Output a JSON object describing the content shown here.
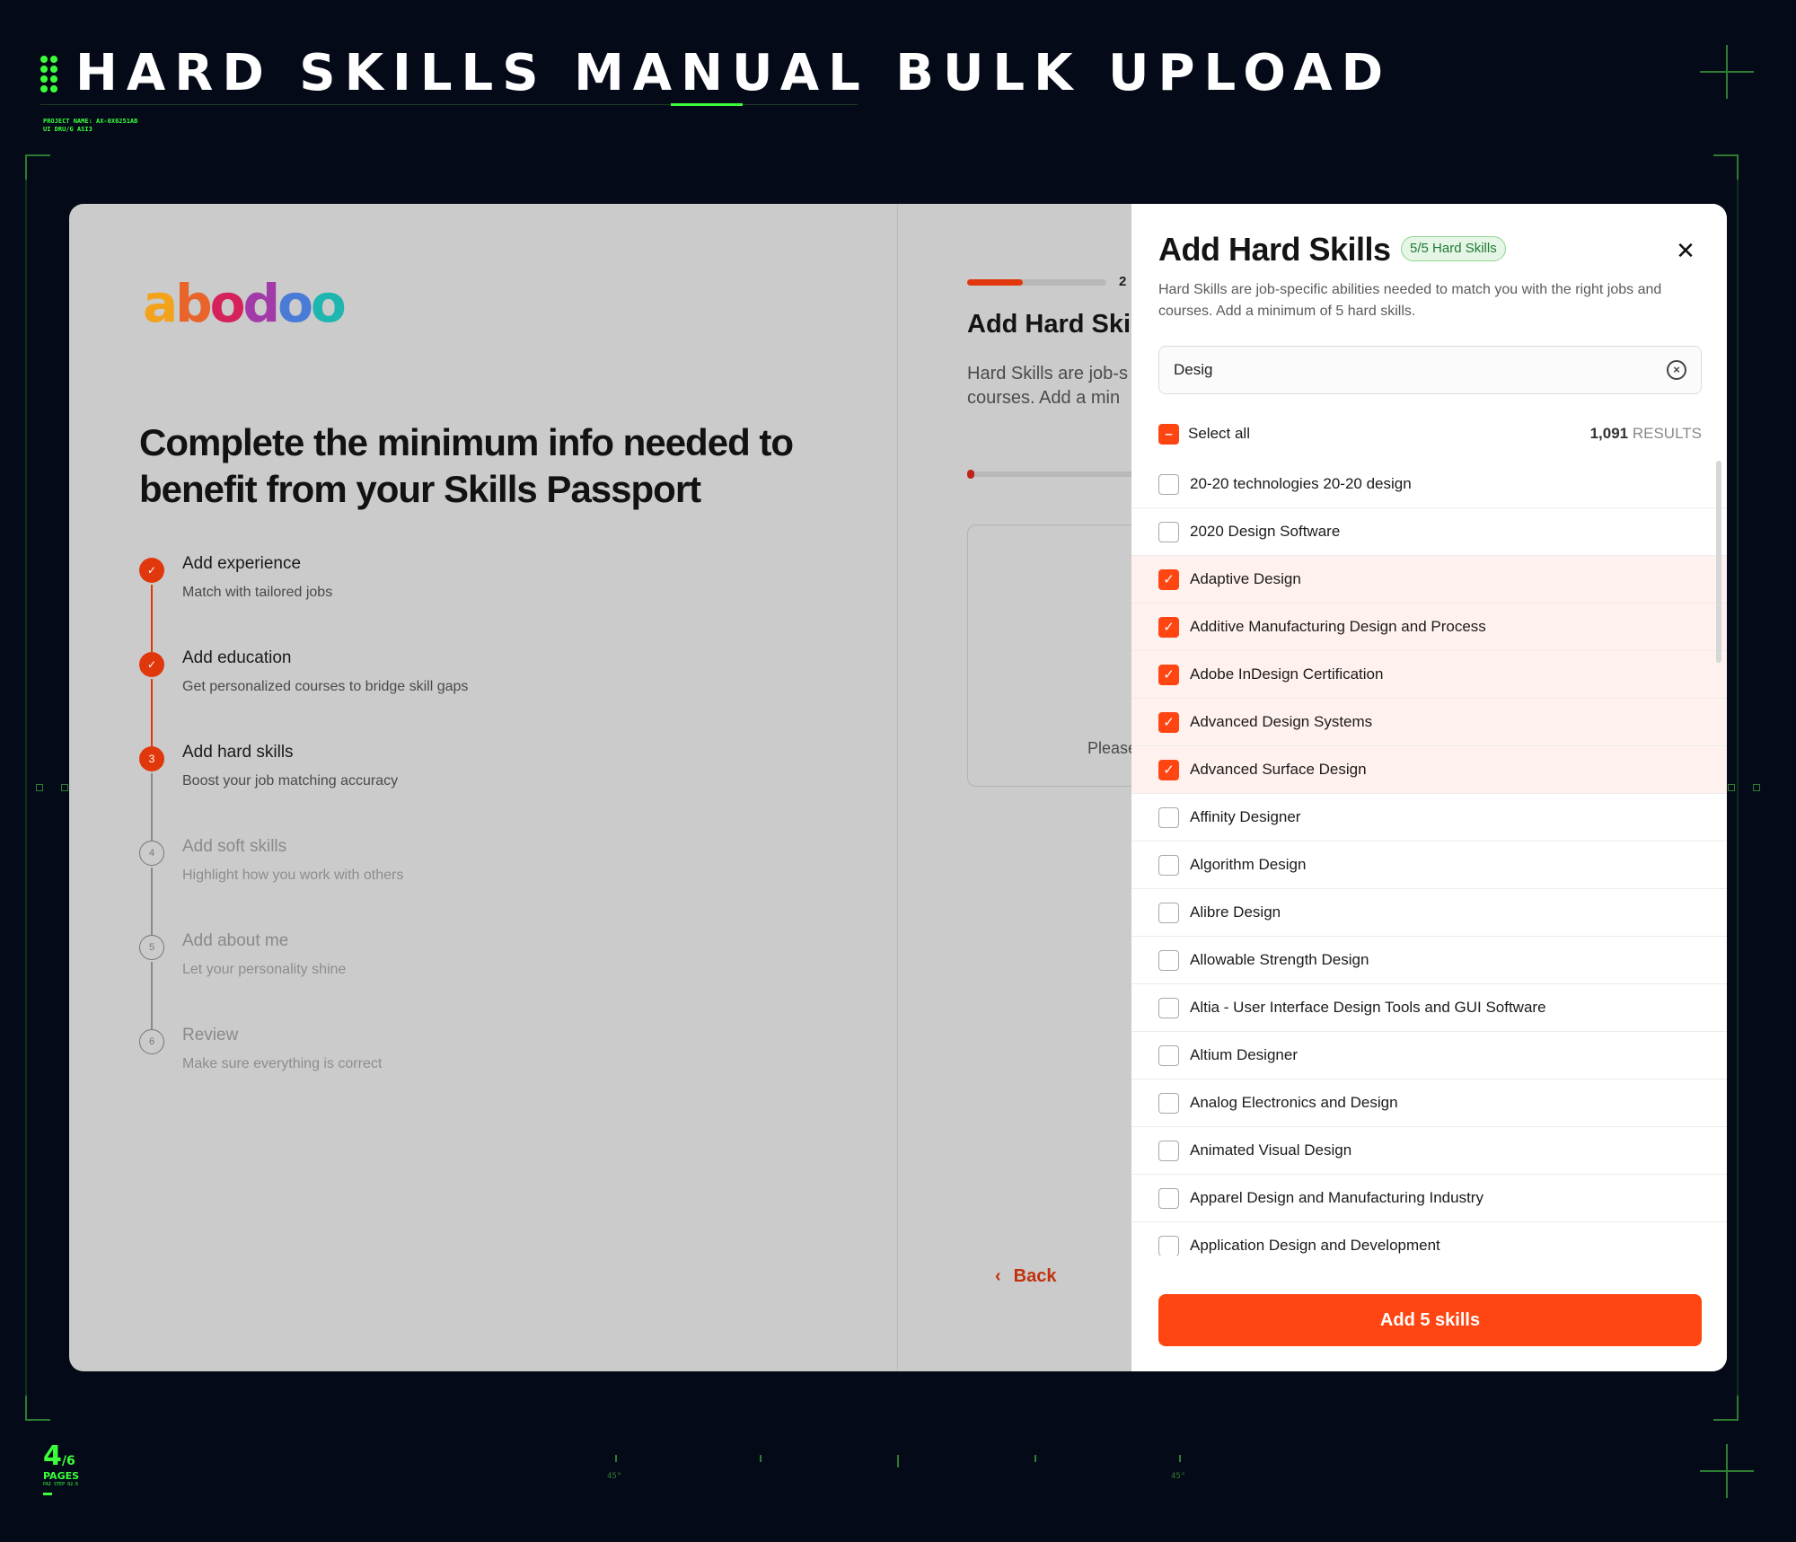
{
  "hud": {
    "title": "HARD SKILLS MANUAL BULK UPLOAD",
    "project_line1": "PROJECT NAME: AX-0X6251AB",
    "project_line2": "UI DRU/G ASI3",
    "page_current": "4",
    "page_total": "/6",
    "pages_label": "PAGES",
    "pages_sub": "PAI STEP 02.6",
    "deg_left": "45°",
    "deg_right": "45°",
    "accent_color": "#3cff3c"
  },
  "left": {
    "logo": "abodoo",
    "headline": "Complete the minimum info needed to benefit from your Skills Passport",
    "steps": [
      {
        "num": "✓",
        "title": "Add experience",
        "subtitle": "Match with tailored jobs",
        "state": "done"
      },
      {
        "num": "✓",
        "title": "Add education",
        "subtitle": "Get personalized courses to bridge skill gaps",
        "state": "done"
      },
      {
        "num": "3",
        "title": "Add hard skills",
        "subtitle": "Boost your job matching accuracy",
        "state": "active"
      },
      {
        "num": "4",
        "title": "Add soft skills",
        "subtitle": "Highlight how you work with others",
        "state": "pending"
      },
      {
        "num": "5",
        "title": "Add about me",
        "subtitle": "Let your personality shine",
        "state": "pending"
      },
      {
        "num": "6",
        "title": "Review",
        "subtitle": "Make sure everything is correct",
        "state": "pending"
      }
    ]
  },
  "middle": {
    "progress_label": "2",
    "title": "Add Hard Skil",
    "desc_line1": "Hard Skills are job-s",
    "desc_line2": "courses. Add a min",
    "please": "Please",
    "back_label": "Back"
  },
  "modal": {
    "title": "Add Hard Skills",
    "badge": "5/5 Hard Skills",
    "close_icon": "close-icon",
    "description": "Hard Skills are job-specific abilities needed to match you with the right jobs and courses. Add a minimum of 5 hard skills.",
    "search_value": "Desig",
    "select_all_label": "Select all",
    "results_count": "1,091",
    "results_label": "RESULTS",
    "items": [
      {
        "label": "20-20 technologies 20-20 design",
        "checked": false
      },
      {
        "label": "2020 Design Software",
        "checked": false
      },
      {
        "label": "Adaptive Design",
        "checked": true
      },
      {
        "label": "Additive Manufacturing Design and Process",
        "checked": true
      },
      {
        "label": "Adobe InDesign Certification",
        "checked": true
      },
      {
        "label": "Advanced Design Systems",
        "checked": true
      },
      {
        "label": "Advanced Surface Design",
        "checked": true
      },
      {
        "label": "Affinity Designer",
        "checked": false
      },
      {
        "label": "Algorithm Design",
        "checked": false
      },
      {
        "label": "Alibre Design",
        "checked": false
      },
      {
        "label": "Allowable Strength Design",
        "checked": false
      },
      {
        "label": "Altia - User Interface Design Tools and GUI Software",
        "checked": false
      },
      {
        "label": "Altium Designer",
        "checked": false
      },
      {
        "label": "Analog Electronics and Design",
        "checked": false
      },
      {
        "label": "Animated Visual Design",
        "checked": false
      },
      {
        "label": "Apparel Design and Manufacturing Industry",
        "checked": false
      },
      {
        "label": "Application Design and Development",
        "checked": false
      }
    ],
    "add_button": "Add 5 skills",
    "brand_color": "#ff4511"
  }
}
